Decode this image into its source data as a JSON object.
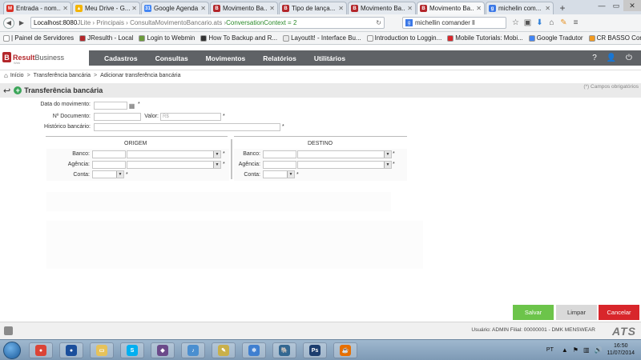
{
  "browser": {
    "tabs": [
      {
        "title": "Entrada - nom...",
        "icon": "gmail-icon",
        "color": "#d93025",
        "glyph": "M",
        "active": false
      },
      {
        "title": "Meu Drive - G...",
        "icon": "drive-icon",
        "color": "#f4b400",
        "glyph": "▲",
        "active": false
      },
      {
        "title": "Google Agenda",
        "icon": "calendar-icon",
        "color": "#4285f4",
        "glyph": "31",
        "active": false
      },
      {
        "title": "Movimento Ba...",
        "icon": "resulth-icon",
        "color": "#b3262a",
        "glyph": "B",
        "active": false
      },
      {
        "title": "Tipo de lança...",
        "icon": "resulth-icon",
        "color": "#b3262a",
        "glyph": "B",
        "active": false
      },
      {
        "title": "Movimento Ba...",
        "icon": "resulth-icon",
        "color": "#b3262a",
        "glyph": "B",
        "active": false
      },
      {
        "title": "Movimento Ba...",
        "icon": "resulth-icon",
        "color": "#b3262a",
        "glyph": "B",
        "active": true
      },
      {
        "title": "michelin com...",
        "icon": "search-icon",
        "color": "#3b78e7",
        "glyph": "g",
        "active": false
      }
    ],
    "url_host": "Localhost:8080",
    "url_path": " JLite › Principais › ConsultaMovimentoBancario.ats › ",
    "url_context": "ConversationContext = 2",
    "search_value": "michellin comander ll",
    "bookmarks": [
      {
        "label": "| Painel de Servidores",
        "color": "#ffffff"
      },
      {
        "label": "JResulth - Local",
        "color": "#b3262a"
      },
      {
        "label": "Login to Webmin",
        "color": "#6a9a3a"
      },
      {
        "label": "How To Backup and R...",
        "color": "#333333"
      },
      {
        "label": "LayoutIt! - Interface Bu...",
        "color": "#e8e8e8"
      },
      {
        "label": "Introduction to Loggin...",
        "color": "#f5f5f5"
      },
      {
        "label": "Mobile Tutorials: Mobi...",
        "color": "#d8262b"
      },
      {
        "label": "Google Tradutor",
        "color": "#4285f4"
      },
      {
        "label": "CR BASSO Consultoria...",
        "color": "#f29a1f"
      }
    ]
  },
  "app": {
    "logo_brand": "Result",
    "logo_rest": "Business",
    "logo_sub": "Web",
    "menu": [
      "Cadastros",
      "Consultas",
      "Movimentos",
      "Relatórios",
      "Utilitários"
    ],
    "breadcrumb": [
      "Início",
      "Transferência bancária",
      "Adicionar transferência bancária"
    ],
    "page_title": "Transferência bancária",
    "required_note": "(*) Campos obrigatórios"
  },
  "form": {
    "data_movimento_label": "Data do movimento:",
    "n_documento_label": "Nº Documento:",
    "valor_label": "Valor:",
    "valor_placeholder": "R$",
    "historico_label": "Histórico bancário:",
    "origem_header": "ORIGEM",
    "destino_header": "DESTINO",
    "banco_label": "Banco:",
    "agencia_label": "Agência:",
    "conta_label": "Conta:",
    "required_mark": "*"
  },
  "actions": {
    "save": "Salvar",
    "clear": "Limpar",
    "cancel": "Cancelar"
  },
  "footer": {
    "user_info": "Usuário: ADMIN   Filial: 00000001 - DMK MENSWEAR",
    "brand": "ATS"
  },
  "taskbar": {
    "language": "PT",
    "time": "16:50",
    "date": "11/07/2014",
    "apps": [
      {
        "icon": "chrome-icon",
        "color": "#db4437",
        "glyph": "●"
      },
      {
        "icon": "media-player-icon",
        "color": "#1b4f9c",
        "glyph": "●"
      },
      {
        "icon": "explorer-folder-icon",
        "color": "#e6c25a",
        "glyph": "▭"
      },
      {
        "icon": "skype-icon",
        "color": "#00aff0",
        "glyph": "S"
      },
      {
        "icon": "game-icon",
        "color": "#6b4a8a",
        "glyph": "◆"
      },
      {
        "icon": "itunes-icon",
        "color": "#4a8fd0",
        "glyph": "♪"
      },
      {
        "icon": "notes-icon",
        "color": "#c9b04a",
        "glyph": "✎"
      },
      {
        "icon": "network-icon",
        "color": "#3f7fd0",
        "glyph": "✲"
      },
      {
        "icon": "postgres-icon",
        "color": "#336791",
        "glyph": "🐘"
      },
      {
        "icon": "photoshop-icon",
        "color": "#1c3d6e",
        "glyph": "Ps"
      },
      {
        "icon": "java-icon",
        "color": "#e76f00",
        "glyph": "☕"
      }
    ]
  }
}
